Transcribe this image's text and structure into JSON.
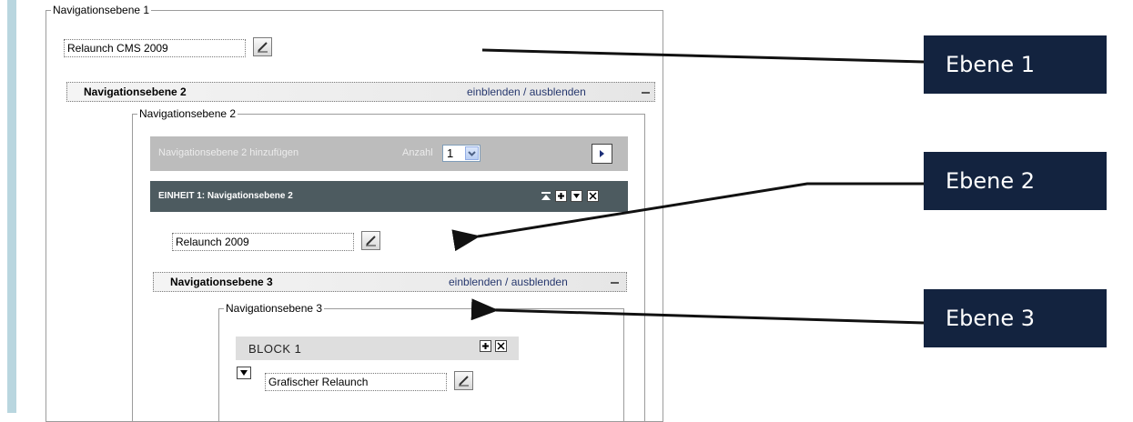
{
  "level1": {
    "legend": "Navigationsebene 1",
    "input_value": "Relaunch CMS 2009",
    "toggle": {
      "title": "Navigationsebene 2",
      "link": "einblenden / ausblenden"
    }
  },
  "level2": {
    "legend": "Navigationsebene 2",
    "add_bar": {
      "label": "Navigationsebene 2 hinzufügen",
      "count_label": "Anzahl",
      "count_value": "1"
    },
    "unit_bar": {
      "title": "EINHEIT 1: Navigationsebene 2"
    },
    "input_value": "Relaunch 2009",
    "toggle": {
      "title": "Navigationsebene 3",
      "link": "einblenden / ausblenden"
    }
  },
  "level3": {
    "legend": "Navigationsebene 3",
    "block_title": "BLOCK 1",
    "input_value": "Grafischer Relaunch"
  },
  "callouts": [
    {
      "label": "Ebene 1"
    },
    {
      "label": "Ebene 2"
    },
    {
      "label": "Ebene 3"
    }
  ],
  "colors": {
    "callout_bg": "#13233f",
    "unit_bar_bg": "#4d5b60",
    "add_bar_bg": "#bcbcbc",
    "link": "#27386e",
    "side_bar": "#b9d6df"
  }
}
